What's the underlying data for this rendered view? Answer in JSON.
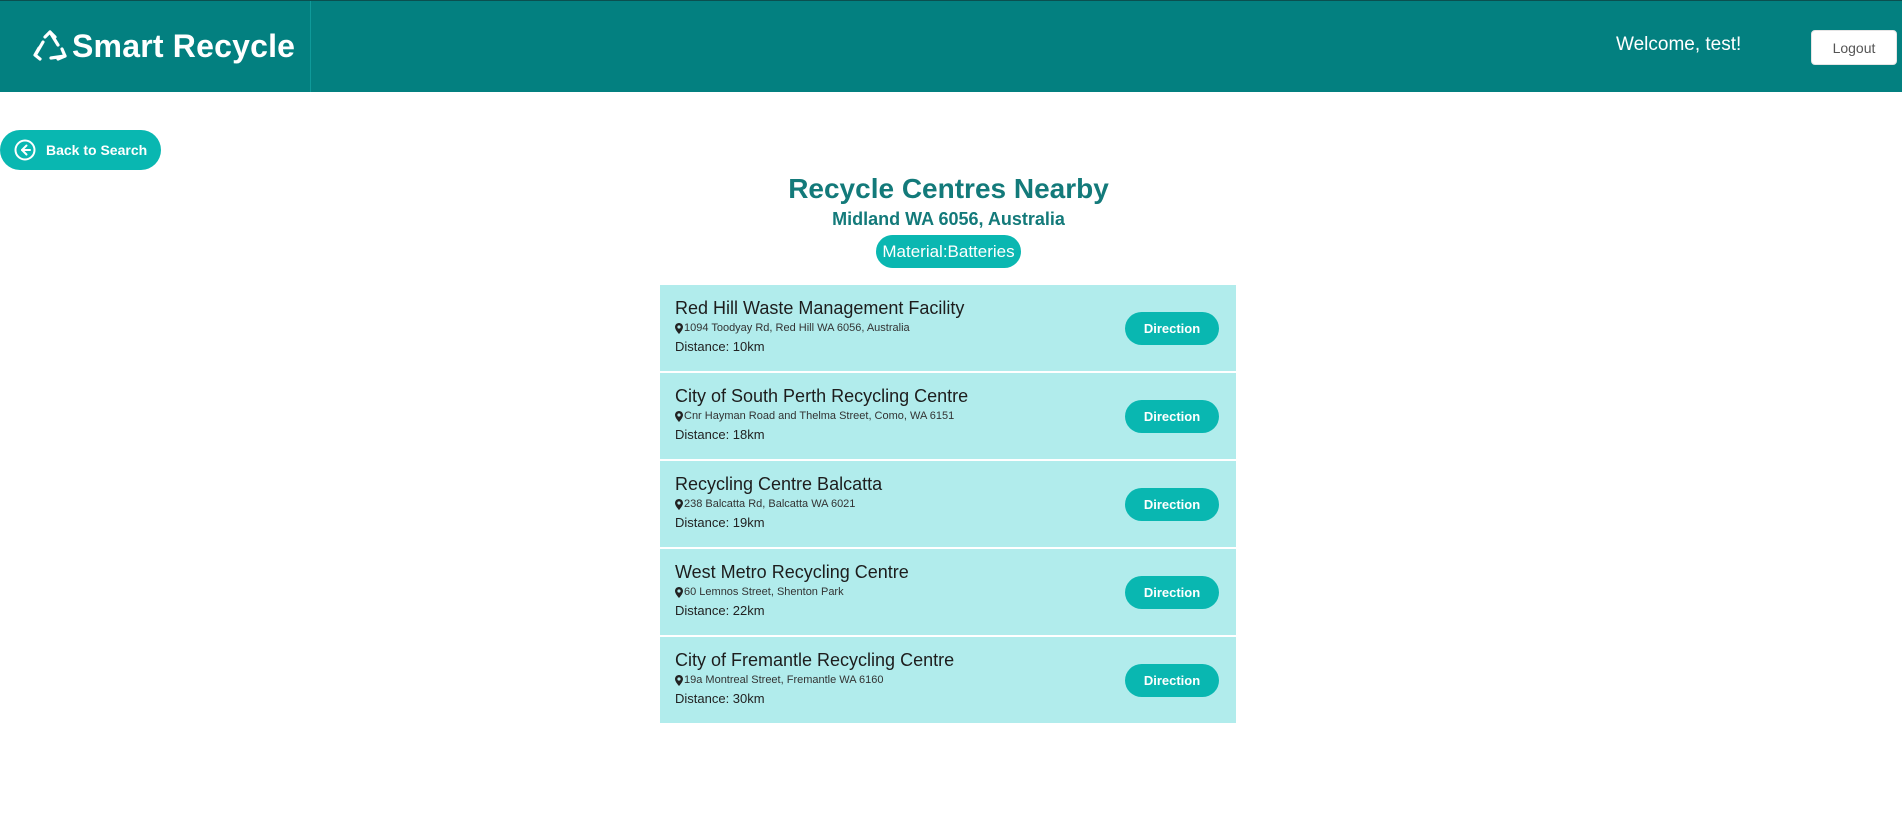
{
  "header": {
    "brand": "Smart Recycle",
    "welcome": "Welcome, test!",
    "logout_label": "Logout"
  },
  "nav": {
    "back_label": "Back to Search"
  },
  "search": {
    "title": "Recycle Centres Nearby",
    "location": "Midland WA 6056, Australia",
    "material": "Material:Batteries"
  },
  "results": [
    {
      "name": "Red Hill Waste Management Facility",
      "address": "1094 Toodyay Rd, Red Hill WA 6056, Australia",
      "distance": "Distance: 10km",
      "action": "Direction"
    },
    {
      "name": "City of South Perth Recycling Centre",
      "address": "Cnr Hayman Road and Thelma Street, Como, WA 6151",
      "distance": "Distance: 18km",
      "action": "Direction"
    },
    {
      "name": "Recycling Centre Balcatta",
      "address": "238 Balcatta Rd, Balcatta WA 6021",
      "distance": "Distance: 19km",
      "action": "Direction"
    },
    {
      "name": "West Metro Recycling Centre",
      "address": "60 Lemnos Street, Shenton Park",
      "distance": "Distance: 22km",
      "action": "Direction"
    },
    {
      "name": "City of Fremantle Recycling Centre",
      "address": "19a Montreal Street, Fremantle WA 6160",
      "distance": "Distance: 30km",
      "action": "Direction"
    }
  ],
  "icons": {
    "brand": "recycle-icon",
    "back": "arrow-left-circle-icon",
    "address": "map-pin-icon"
  },
  "colors": {
    "primary": "#038080",
    "accent": "#09b7b1",
    "card_bg": "#b1ecec",
    "title": "#137a7a"
  }
}
